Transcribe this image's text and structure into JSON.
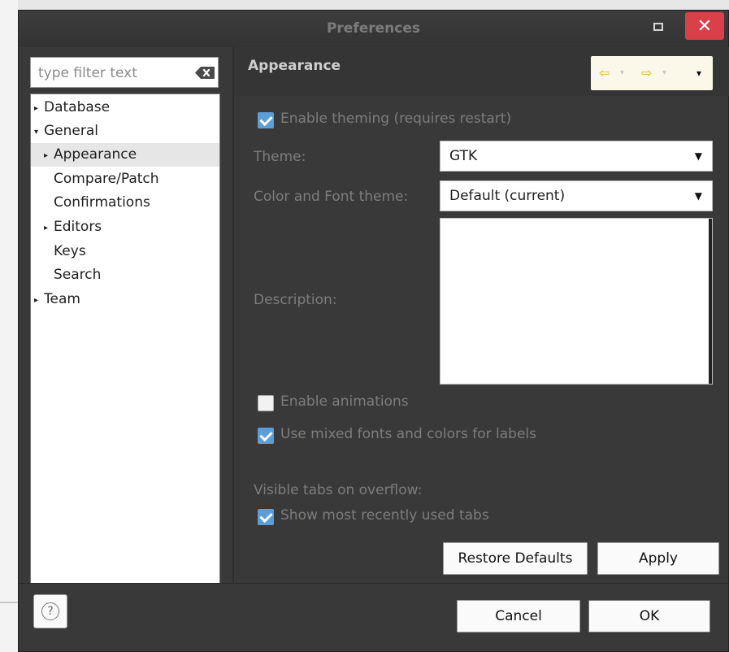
{
  "window": {
    "title": "Preferences"
  },
  "filter": {
    "placeholder": "type filter text"
  },
  "tree": {
    "items": [
      {
        "label": "Database",
        "expander": "▸"
      },
      {
        "label": "General",
        "expander": "▾"
      },
      {
        "label": "Appearance",
        "expander": "▸"
      },
      {
        "label": "Compare/Patch",
        "expander": ""
      },
      {
        "label": "Confirmations",
        "expander": ""
      },
      {
        "label": "Editors",
        "expander": "▸"
      },
      {
        "label": "Keys",
        "expander": ""
      },
      {
        "label": "Search",
        "expander": ""
      },
      {
        "label": "Team",
        "expander": "▸"
      }
    ]
  },
  "page": {
    "title": "Appearance",
    "nav": {
      "back_icon": "⇦",
      "forward_icon": "⇨",
      "dropdown_icon": "▾",
      "menu_icon": "▾"
    },
    "enable_theming": {
      "label": "Enable theming (requires restart)",
      "checked": true
    },
    "theme": {
      "label": "Theme:",
      "value": "GTK"
    },
    "color_font_theme": {
      "label": "Color and Font theme:",
      "value": "Default (current)"
    },
    "description": {
      "label": "Description:",
      "value": ""
    },
    "enable_animations": {
      "label": "Enable animations",
      "checked": false
    },
    "mixed_fonts": {
      "label": "Use mixed fonts and colors for labels",
      "checked": true
    },
    "visible_tabs_heading": "Visible tabs on overflow:",
    "show_recent_tabs": {
      "label": "Show most recently used tabs",
      "checked": true
    },
    "restore_defaults_label": "Restore Defaults",
    "apply_label": "Apply"
  },
  "dialog": {
    "cancel_label": "Cancel",
    "ok_label": "OK",
    "help_icon": "?",
    "close_icon": "✕"
  },
  "colors": {
    "accent": "#5c9ed6",
    "close_button": "#d9404a",
    "nav_arrows": "#e6b13a"
  }
}
